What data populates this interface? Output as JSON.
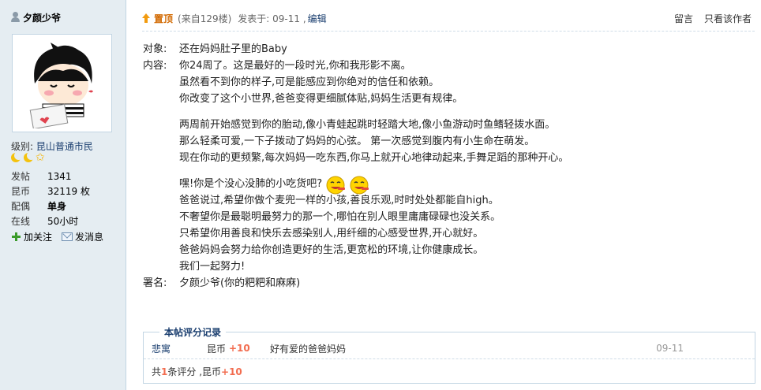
{
  "user": {
    "name": "夕颜少爷",
    "level_label": "级别:",
    "level_value": "昆山普通市民",
    "stats": [
      {
        "key": "发帖",
        "value": "1341",
        "bold": false
      },
      {
        "key": "昆币",
        "value": "32119 枚",
        "bold": false
      },
      {
        "key": "配偶",
        "value": "单身",
        "bold": true
      },
      {
        "key": "在线",
        "value": "50小时",
        "bold": false
      }
    ],
    "actions": {
      "follow": "加关注",
      "message": "发消息"
    }
  },
  "post": {
    "pin_label": "置顶",
    "floor_info": "(来自129楼)",
    "posted": "发表于: 09-11 ,",
    "edit": "编辑",
    "reply": "留言",
    "only_author": "只看该作者",
    "lines": {
      "l1_prefix": "对象:",
      "l1": "还在妈妈肚子里的Baby",
      "l2_prefix": "内容:",
      "l2": "你24周了。这是最好的一段时光,你和我形影不离。",
      "l3": "虽然看不到你的样子,可是能感应到你绝对的信任和依赖。",
      "l4": "你改变了这个小世界,爸爸变得更细腻体贴,妈妈生活更有规律。",
      "l5": "两周前开始感觉到你的胎动,像小青蛙起跳时轻踏大地,像小鱼游动时鱼鳍轻拨水面。",
      "l6": "那么轻柔可爱,一下子拨动了妈妈的心弦。 第一次感觉到腹内有小生命在萌发。",
      "l7": "现在你动的更频繁,每次妈妈一吃东西,你马上就开心地律动起来,手舞足蹈的那种开心。",
      "l8": "嘿!你是个没心没肺的小吃货吧?",
      "l9": "爸爸说过,希望你做个麦兜一样的小孩,善良乐观,时时处处都能自high。",
      "l10": "不奢望你是最聪明最努力的那一个,哪怕在别人眼里庸庸碌碌也没关系。",
      "l11": "只希望你用善良和快乐去感染别人,用纤细的心感受世界,开心就好。",
      "l12": "爸爸妈妈会努力给你创造更好的生活,更宽松的环境,让你健康成长。",
      "l13": "我们一起努力!",
      "l14_prefix": "署名:",
      "l14": "夕颜少爷(你的粑粑和麻麻)"
    }
  },
  "rating": {
    "title": "本帖评分记录",
    "rows": [
      {
        "who": "悲寓",
        "currency": "昆币",
        "points": "+10",
        "reason": "好有爱的爸爸妈妈",
        "date": "09-11"
      }
    ],
    "total_prefix": "共",
    "total_count": "1",
    "total_mid": "条评分 ,昆币",
    "total_points": "+10"
  },
  "colors": {
    "sidebar_bg": "#e5edf2",
    "border": "#c2d5e3",
    "link": "#1a3e6f",
    "pin": "#d26900",
    "points": "#f26c4f"
  }
}
